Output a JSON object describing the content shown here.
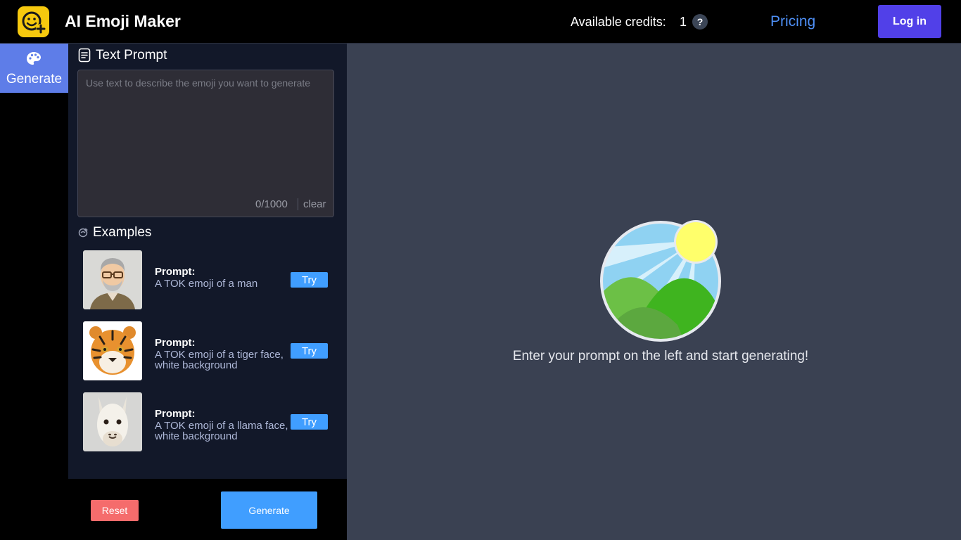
{
  "header": {
    "app_title": "AI Emoji Maker",
    "credits_label": "Available credits:",
    "credits_value": "1",
    "help_symbol": "?",
    "pricing_label": "Pricing",
    "login_label": "Log in",
    "logo_icon": "emoji-add-icon"
  },
  "nav": {
    "generate_label": "Generate",
    "generate_icon": "palette-icon"
  },
  "prompt": {
    "title": "Text Prompt",
    "placeholder": "Use text to describe the emoji you want to generate",
    "value": "",
    "char_count": "0/1000",
    "clear_label": "clear"
  },
  "examples": {
    "title": "Examples",
    "items": [
      {
        "label": "Prompt:",
        "text": "A TOK emoji of a man",
        "try_label": "Try",
        "thumb": "man-emoji"
      },
      {
        "label": "Prompt:",
        "text": "A TOK emoji of a tiger face, white background",
        "try_label": "Try",
        "thumb": "tiger-emoji"
      },
      {
        "label": "Prompt:",
        "text": "A TOK emoji of a llama face, white background",
        "try_label": "Try",
        "thumb": "llama-emoji"
      }
    ]
  },
  "actions": {
    "reset_label": "Reset",
    "generate_label": "Generate"
  },
  "preview": {
    "message": "Enter your prompt on the left and start generating!",
    "icon": "landscape-image-icon"
  },
  "colors": {
    "accent": "#5140e8",
    "link": "#4e8ff5",
    "button_primary": "#409eff",
    "button_reset": "#f56c6c",
    "nav_active": "#5e7de8",
    "logo": "#f6c90e"
  }
}
